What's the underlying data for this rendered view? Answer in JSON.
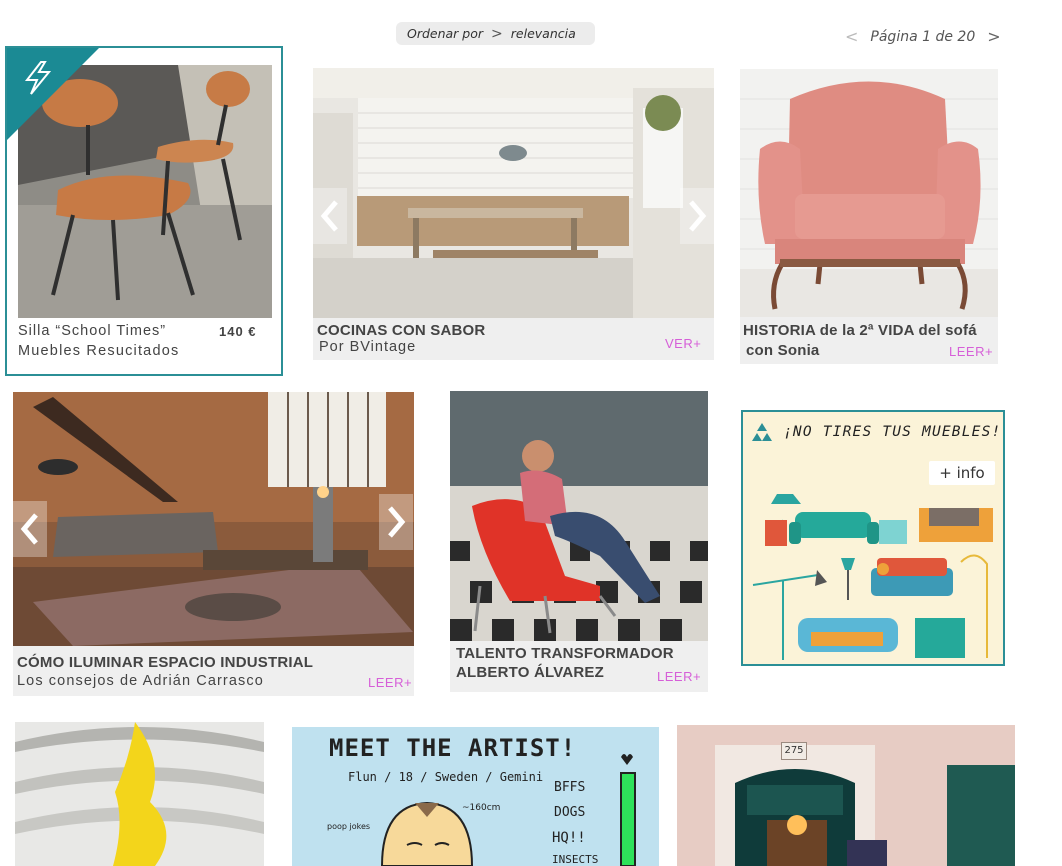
{
  "sort": {
    "label": "Ordenar por",
    "chevron": ">",
    "value": "relevancia"
  },
  "pagination": {
    "prev": "<",
    "text": "Página 1 de 20",
    "next": ">"
  },
  "cards": [
    {
      "title": "Silla “School Times”",
      "price": "140 €",
      "subtitle": "Muebles Resucitados"
    },
    {
      "title": "COCINAS CON SABOR",
      "subtitle": "Por BVintage",
      "more": "VER+"
    },
    {
      "title": "HISTORIA de la 2ª VIDA del sofá",
      "title2": "con Sonia",
      "more": "LEER+"
    },
    {
      "title": "CÓMO ILUMINAR ESPACIO INDUSTRIAL",
      "subtitle": "Los consejos de Adrián Carrasco",
      "more": "LEER+"
    },
    {
      "title": "TALENTO TRANSFORMADOR",
      "title2": "ALBERTO ÁLVAREZ",
      "more": "LEER+"
    }
  ],
  "ad": {
    "headline": "¡NO TIRES TUS MUEBLES!",
    "cta": "+ info",
    "icon": "recycle-icon"
  },
  "artist": {
    "title": "MEET THE ARTIST!",
    "subtitle": "Flun / 18 / Sweden / Gemini",
    "height_note": "~160cm",
    "side_note": "poop jokes",
    "list": [
      "BFFS",
      "DOGS",
      "HQ!!",
      "INSECTS"
    ]
  },
  "storefront": {
    "number": "275"
  },
  "colors": {
    "accent": "#2b8f96",
    "more_link": "#d65fd8",
    "caption_bg": "#efefef"
  }
}
